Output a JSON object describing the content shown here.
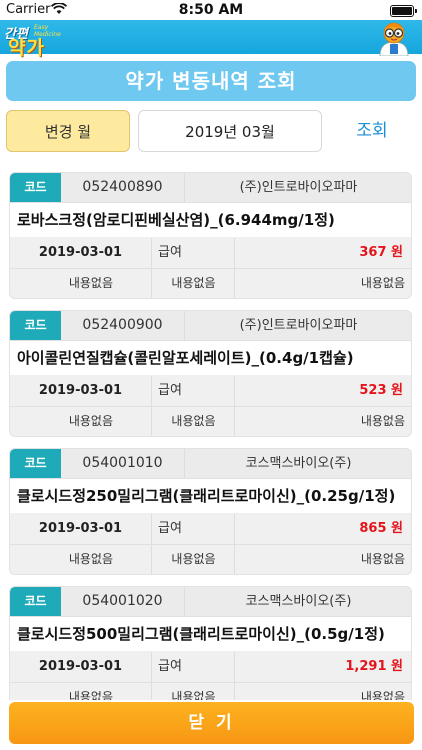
{
  "status": {
    "carrier": "Carrier",
    "time": "8:50 AM"
  },
  "app": {
    "logo_top": "간편",
    "logo_bottom": "약가",
    "logo_small": "Easy Medicine"
  },
  "title": "약가 변동내역 조회",
  "month": {
    "label": "변경 월",
    "value": "2019년 03월",
    "search_label": "조회"
  },
  "cards": [
    {
      "code_label": "코드",
      "code": "052400890",
      "maker": "(주)인트로바이오파마",
      "name": "로바스크정(암로디핀베실산염)_(6.944mg/1정)",
      "date": "2019-03-01",
      "type": "급여",
      "price": "367 원",
      "note1": "내용없음",
      "note2": "내용없음",
      "note3": "내용없음"
    },
    {
      "code_label": "코드",
      "code": "052400900",
      "maker": "(주)인트로바이오파마",
      "name": "아이콜린연질캡슐(콜린알포세레이트)_(0.4g/1캡슐)",
      "date": "2019-03-01",
      "type": "급여",
      "price": "523 원",
      "note1": "내용없음",
      "note2": "내용없음",
      "note3": "내용없음"
    },
    {
      "code_label": "코드",
      "code": "054001010",
      "maker": "코스맥스바이오(주)",
      "name": "클로시드정250밀리그램(클래리트로마이신)_(0.25g/1정)",
      "date": "2019-03-01",
      "type": "급여",
      "price": "865 원",
      "note1": "내용없음",
      "note2": "내용없음",
      "note3": "내용없음"
    },
    {
      "code_label": "코드",
      "code": "054001020",
      "maker": "코스맥스바이오(주)",
      "name": "클로시드정500밀리그램(클래리트로마이신)_(0.5g/1정)",
      "date": "2019-03-01",
      "type": "급여",
      "price": "1,291 원",
      "note1": "내용없음",
      "note2": "내용없음",
      "note3": "내용없음"
    }
  ],
  "close_label": "닫 기",
  "colors": {
    "header": "#16a6dc",
    "title_bar": "#6fc8ef",
    "code_tag": "#1eaab8",
    "price": "#e3141b",
    "close_button": "#f79714",
    "month_label_bg": "#fdea9f"
  }
}
